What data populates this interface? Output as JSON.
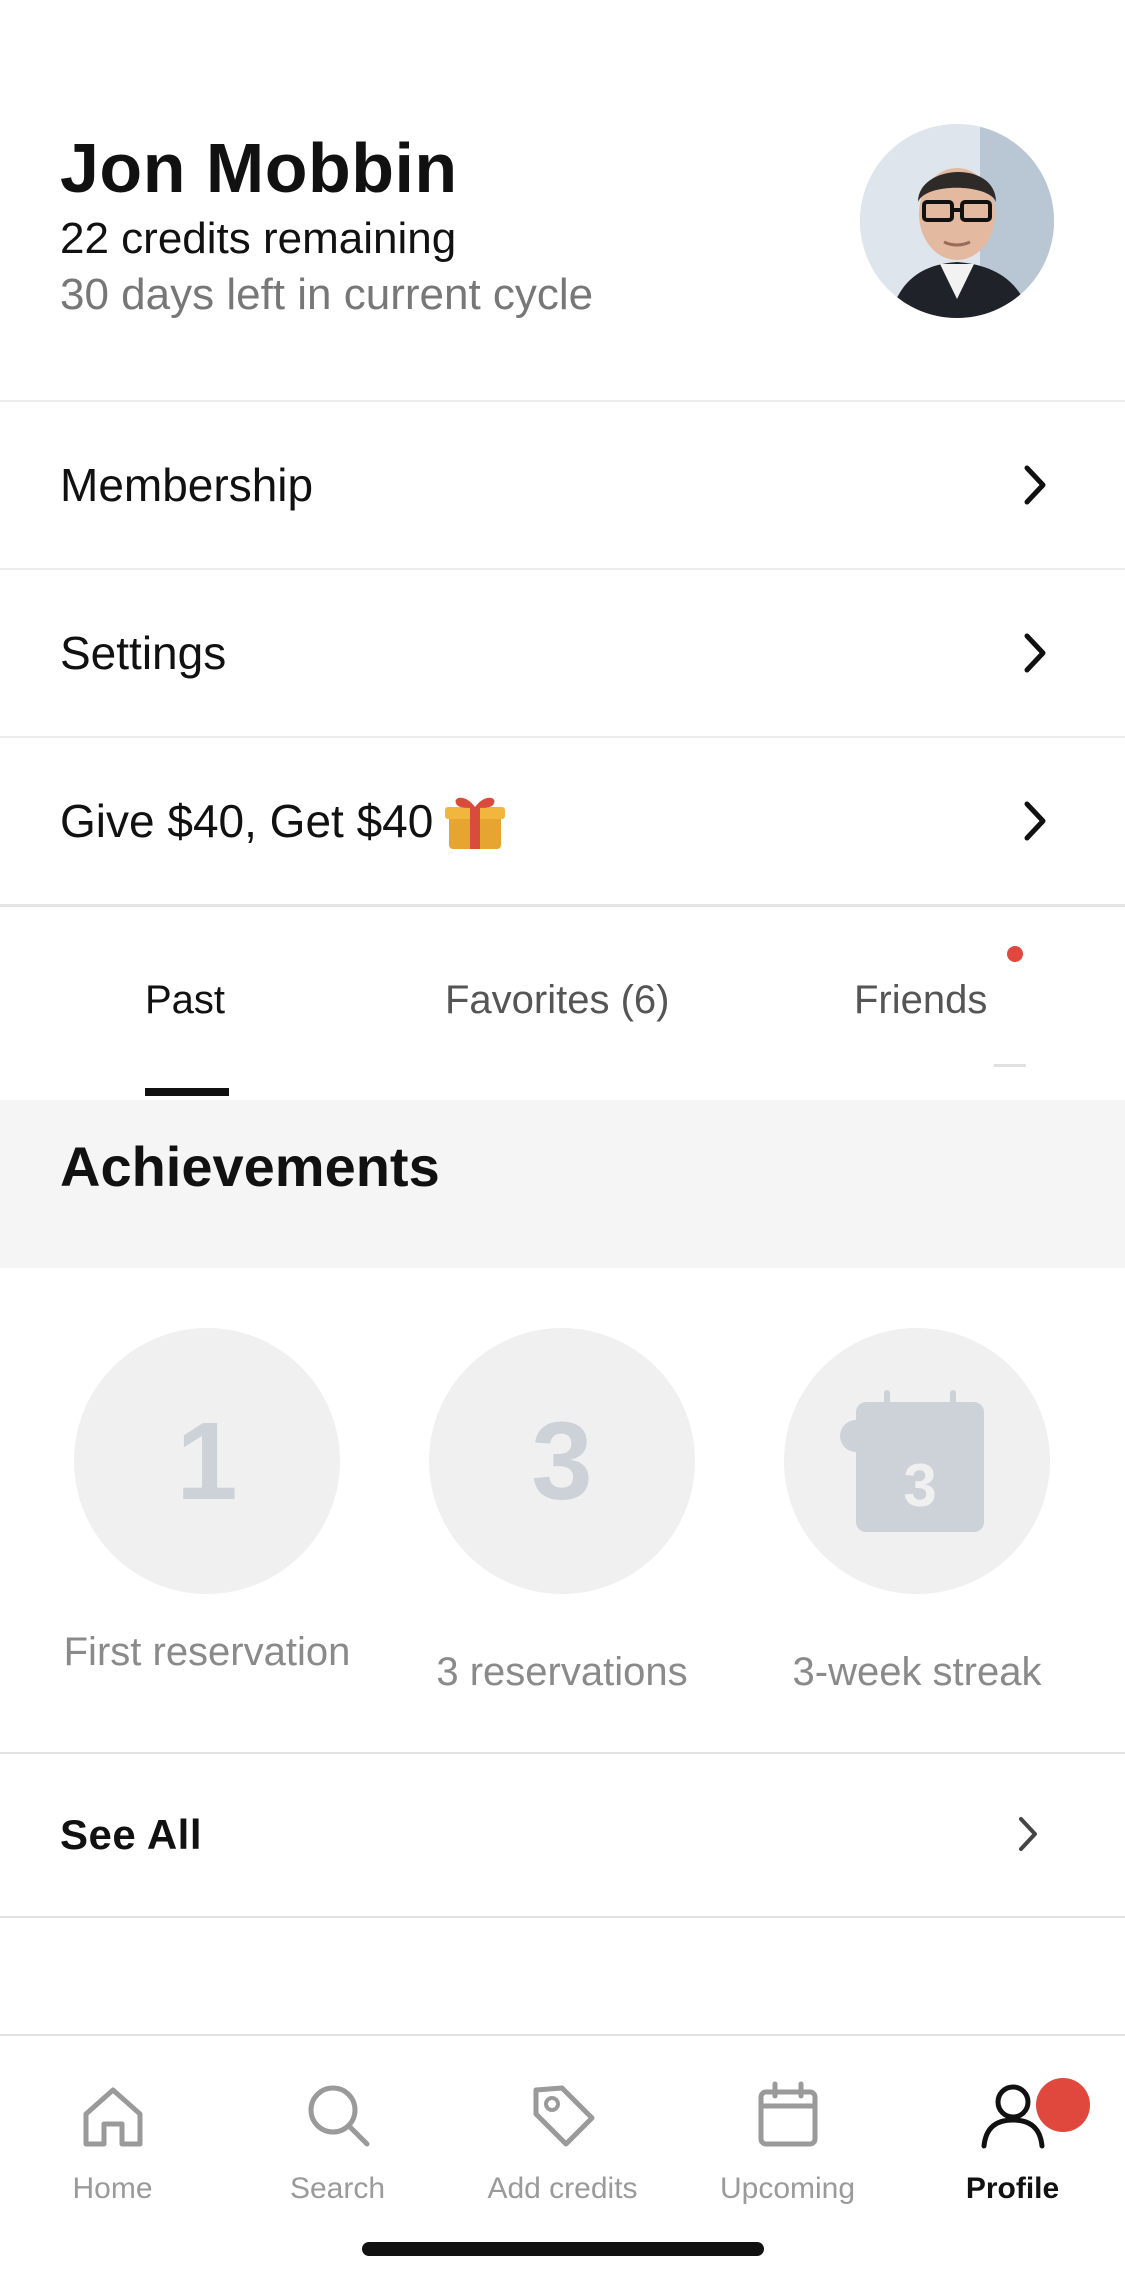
{
  "profile": {
    "name": "Jon Mobbin",
    "credits": "22 credits remaining",
    "cycle": "30 days left in current cycle"
  },
  "menu": [
    {
      "label": "Membership"
    },
    {
      "label": "Settings"
    },
    {
      "label": "Give $40, Get $40"
    }
  ],
  "tabs": [
    {
      "label": "Past",
      "active": true
    },
    {
      "label": "Favorites (6)",
      "active": false
    },
    {
      "label": "Friends",
      "active": false,
      "has_notification": true
    }
  ],
  "achievements": {
    "title": "Achievements",
    "badges": [
      {
        "value": "1",
        "label": "First reservation"
      },
      {
        "value": "3",
        "label": "3 reservations"
      },
      {
        "value": "3",
        "label": "3-week streak",
        "icon": "calendar-icon"
      }
    ],
    "see_all": "See All"
  },
  "bottom_nav": [
    {
      "label": "Home",
      "icon": "home-icon"
    },
    {
      "label": "Search",
      "icon": "search-icon"
    },
    {
      "label": "Add credits",
      "icon": "tag-icon"
    },
    {
      "label": "Upcoming",
      "icon": "calendar-icon"
    },
    {
      "label": "Profile",
      "icon": "profile-icon",
      "active": true
    }
  ],
  "colors": {
    "accent_red": "#e0483e",
    "badge_bg": "#f0f0f1",
    "badge_fg": "#cdd2d9"
  }
}
